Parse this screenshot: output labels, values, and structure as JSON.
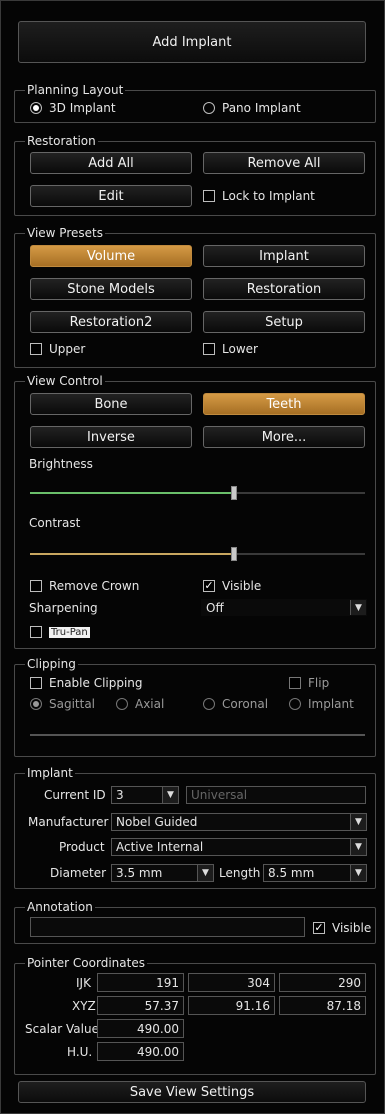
{
  "add_implant_label": "Add Implant",
  "planning_layout": {
    "legend": "Planning Layout",
    "option_3d": "3D Implant",
    "option_pano": "Pano Implant"
  },
  "restoration": {
    "legend": "Restoration",
    "add_all": "Add All",
    "remove_all": "Remove All",
    "edit": "Edit",
    "lock_to_implant": "Lock to Implant"
  },
  "view_presets": {
    "legend": "View Presets",
    "volume": "Volume",
    "implant": "Implant",
    "stone_models": "Stone Models",
    "restoration": "Restoration",
    "restoration2": "Restoration2",
    "setup": "Setup",
    "upper": "Upper",
    "lower": "Lower"
  },
  "view_control": {
    "legend": "View Control",
    "bone": "Bone",
    "teeth": "Teeth",
    "inverse": "Inverse",
    "more": "More...",
    "brightness_label": "Brightness",
    "brightness_value": 0.61,
    "contrast_label": "Contrast",
    "contrast_value": 0.61,
    "remove_crown": "Remove Crown",
    "visible": "Visible",
    "sharpening_label": "Sharpening",
    "sharpening_value": "Off",
    "tru_pan": "Tru-Pan"
  },
  "clipping": {
    "legend": "Clipping",
    "enable_clipping": "Enable Clipping",
    "flip": "Flip",
    "sagittal": "Sagittal",
    "axial": "Axial",
    "coronal": "Coronal",
    "implant": "Implant"
  },
  "implant": {
    "legend": "Implant",
    "current_id_label": "Current ID",
    "current_id_value": "3",
    "universal_placeholder": "Universal",
    "manufacturer_label": "Manufacturer",
    "manufacturer_value": "Nobel Guided",
    "product_label": "Product",
    "product_value": "Active Internal",
    "diameter_label": "Diameter",
    "diameter_value": "3.5 mm",
    "length_label": "Length",
    "length_value": "8.5 mm"
  },
  "annotation": {
    "legend": "Annotation",
    "text_value": "",
    "visible": "Visible"
  },
  "pointer": {
    "legend": "Pointer Coordinates",
    "ijk_label": "IJK",
    "ijk": [
      "191",
      "304",
      "290"
    ],
    "xyz_label": "XYZ",
    "xyz": [
      "57.37",
      "91.16",
      "87.18"
    ],
    "scalar_label": "Scalar Value",
    "scalar_value": "490.00",
    "hu_label": "H.U.",
    "hu_value": "490.00"
  },
  "save_view_settings": "Save View Settings",
  "colors": {
    "accent": "#c8893a",
    "brightness_track": "#6abf6a",
    "contrast_track": "#c9a760"
  }
}
